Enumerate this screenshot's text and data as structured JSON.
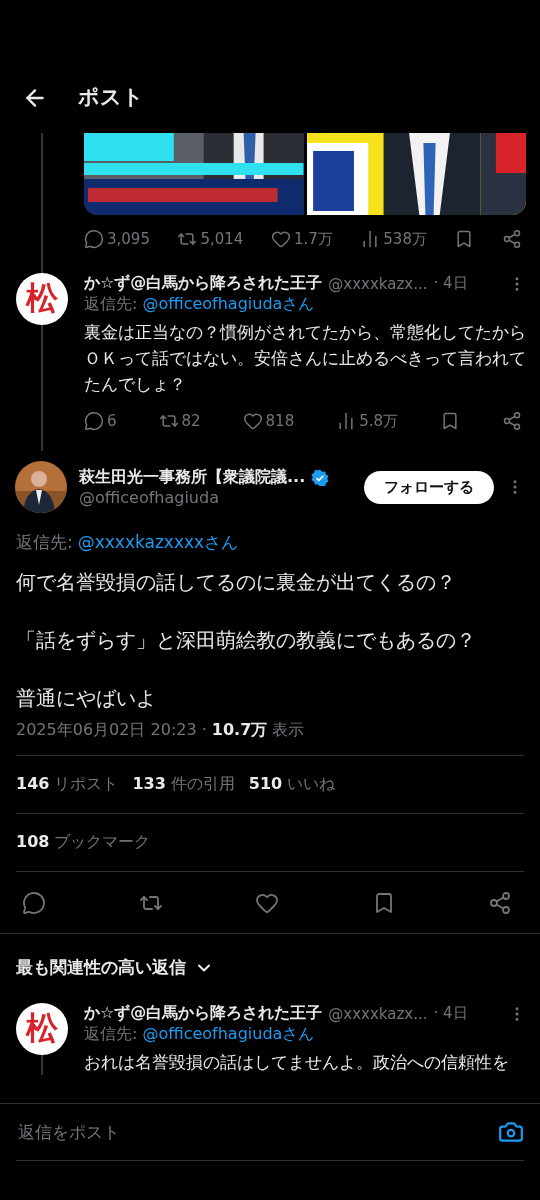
{
  "header": {
    "title": "ポスト"
  },
  "parent_post": {
    "actions": [
      {
        "kind": "reply",
        "count": "3,095"
      },
      {
        "kind": "repost",
        "count": "5,014"
      },
      {
        "kind": "like",
        "count": "1.7万"
      },
      {
        "kind": "views",
        "count": "538万"
      },
      {
        "kind": "bookmark"
      },
      {
        "kind": "share"
      }
    ]
  },
  "reply_above": {
    "avatar_text": "松",
    "name": "か☆ず@白馬から降ろされた王子",
    "handle": "@xxxxkazx...",
    "time": "· 4日",
    "reply_to_label": "返信先:",
    "reply_to": "@officeofhagiudaさん",
    "text": "裏金は正当なの？慣例がされてたから、常態化してたからＯＫって話ではない。安倍さんに止めるべきって言われてたんでしょ？",
    "actions": [
      {
        "kind": "reply",
        "count": "6"
      },
      {
        "kind": "repost",
        "count": "82"
      },
      {
        "kind": "like",
        "count": "818"
      },
      {
        "kind": "views",
        "count": "5.8万"
      },
      {
        "kind": "bookmark"
      },
      {
        "kind": "share"
      }
    ]
  },
  "main_post": {
    "name": "萩生田光一事務所【衆議院議...",
    "verified": true,
    "handle": "@officeofhagiuda",
    "follow_button": "フォローする",
    "reply_to_label": "返信先:",
    "reply_to": "@xxxxkazxxxxさん",
    "paragraphs": [
      "何で名誉毀損の話してるのに裏金が出てくるの？",
      "「話をずらす」と深田萌絵教の教義にでもあるの？",
      "普通にやばいよ"
    ],
    "timestamp": "2025年06月02日 20:23 ·",
    "views": "10.7万",
    "views_label": "表示",
    "stat_rows": [
      [
        {
          "count": "146",
          "label": "リポスト"
        },
        {
          "count": "133",
          "label": "件の引用"
        },
        {
          "count": "510",
          "label": "いいね"
        }
      ],
      [
        {
          "count": "108",
          "label": "ブックマーク"
        }
      ]
    ],
    "actions": [
      {
        "kind": "reply"
      },
      {
        "kind": "repost"
      },
      {
        "kind": "like"
      },
      {
        "kind": "bookmark"
      },
      {
        "kind": "share"
      }
    ]
  },
  "replies_sort": {
    "label": "最も関連性の高い返信"
  },
  "replies": [
    {
      "avatar_text": "松",
      "name": "か☆ず@白馬から降ろされた王子",
      "handle": "@xxxxkazx...",
      "time": "· 4日",
      "reply_to_label": "返信先:",
      "reply_to": "@officeofhagiudaさん",
      "text": "おれは名誉毀損の話はしてませんよ。政治への信頼性を"
    }
  ],
  "composer": {
    "placeholder": "返信をポスト"
  }
}
